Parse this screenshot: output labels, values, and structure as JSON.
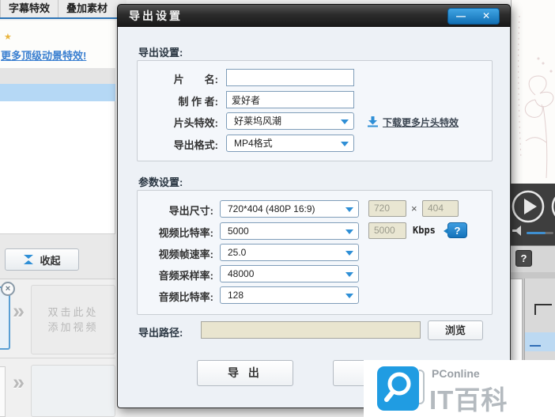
{
  "background": {
    "tab_bar": {
      "tabs": [
        "字幕特效",
        "叠加素材"
      ]
    },
    "left_panel": {
      "more_link": "更多顶级动景特效!",
      "collapse_label": "收起",
      "thumb_close_glyph": "×",
      "chevron_glyph": "»",
      "add_video_line1": "双击此处",
      "add_video_line2": "添加视频"
    },
    "right_panel": {
      "help_glyph": "?"
    }
  },
  "dialog": {
    "title": "导出设置",
    "controls": {
      "minimize": "—",
      "close": "✕"
    },
    "section1": {
      "heading": "导出设置:",
      "rows": [
        {
          "label": "片　　名:",
          "value": ""
        },
        {
          "label": "制 作 者:",
          "value": "爱好者"
        },
        {
          "label": "片头特效:",
          "value": "好莱坞风潮",
          "link": "下载更多片头特效"
        },
        {
          "label": "导出格式:",
          "value": "MP4格式"
        }
      ]
    },
    "section2": {
      "heading": "参数设置:",
      "rows": [
        {
          "label": "导出尺寸:",
          "value": "720*404 (480P 16:9)"
        },
        {
          "label": "视频比特率:",
          "value": "5000"
        },
        {
          "label": "视频帧速率:",
          "value": "25.0"
        },
        {
          "label": "音频采样率:",
          "value": "48000"
        },
        {
          "label": "音频比特率:",
          "value": "128"
        }
      ],
      "size_width": "720",
      "size_times": "×",
      "size_height": "404",
      "bitrate_locked": "5000",
      "bitrate_unit": "Kbps",
      "help_glyph": "?"
    },
    "path_row": {
      "label": "导出路径:",
      "value": "",
      "browse": "浏览"
    },
    "buttons": {
      "export": "导 出"
    }
  },
  "watermark": {
    "brand": "PConline",
    "name": "IT百科"
  },
  "colors": {
    "accent_blue": "#1e8fd5",
    "link_blue": "#3a7fd0",
    "path_beige": "#e9e5cf",
    "titlebar_dark": "#2c2c2c",
    "highlight_row_blue": "#b5d8f5"
  }
}
